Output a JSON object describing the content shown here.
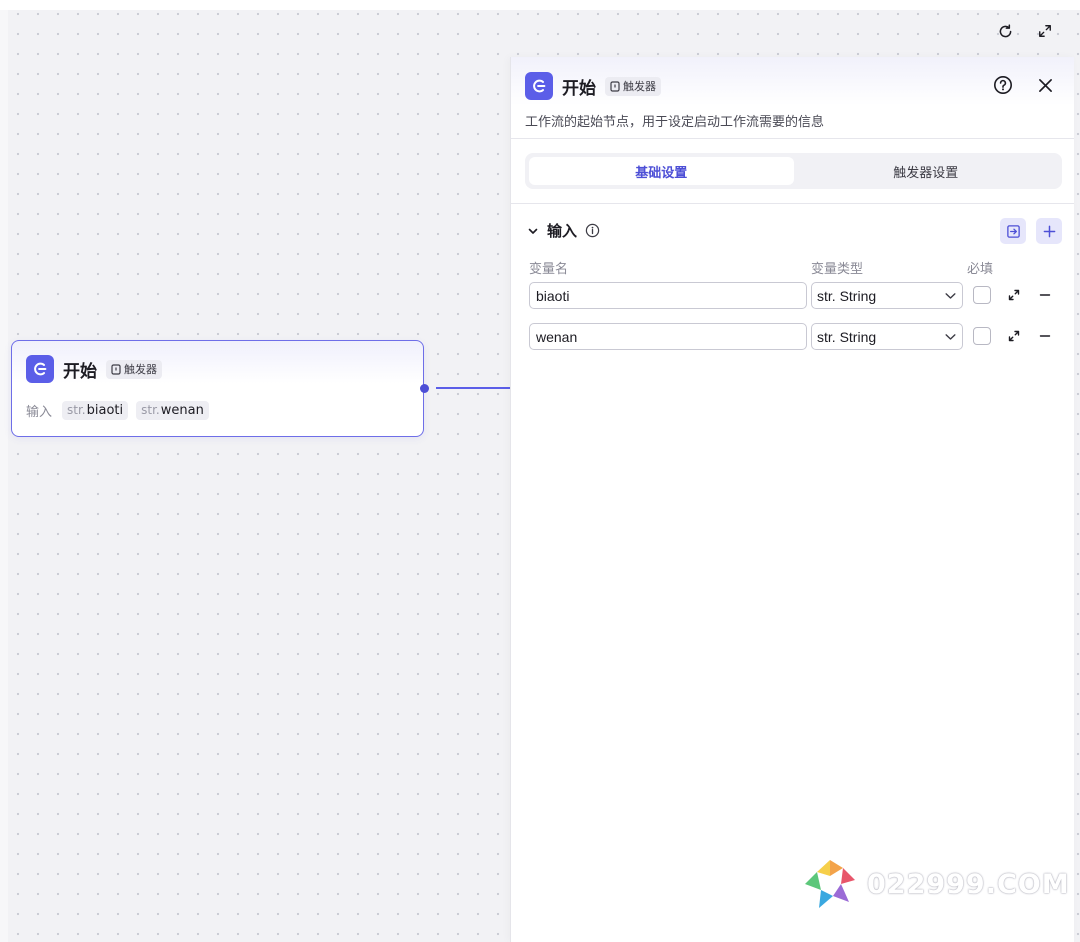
{
  "toolbar": {
    "refresh_icon": "refresh-icon",
    "fullscreen_icon": "expand-icon"
  },
  "node": {
    "title": "开始",
    "trigger_tag": "触发器",
    "io_label": "输入",
    "vars": [
      {
        "type": "str.",
        "name": "biaoti"
      },
      {
        "type": "str.",
        "name": "wenan"
      }
    ]
  },
  "panel": {
    "title": "开始",
    "trigger_tag": "触发器",
    "description": "工作流的起始节点，用于设定启动工作流需要的信息",
    "tabs": [
      {
        "label": "基础设置",
        "active": true
      },
      {
        "label": "触发器设置",
        "active": false
      }
    ],
    "section": {
      "title": "输入",
      "col_name": "变量名",
      "col_type": "变量类型",
      "col_required": "必填"
    },
    "rows": [
      {
        "name": "biaoti",
        "type_prefix": "str.",
        "type": "String",
        "required": false
      },
      {
        "name": "wenan",
        "type_prefix": "str.",
        "type": "String",
        "required": false
      }
    ]
  },
  "colors": {
    "accent": "#5b5ee8",
    "accent_dark": "#4d4fd6"
  },
  "watermark": {
    "text": "022999.COM"
  }
}
